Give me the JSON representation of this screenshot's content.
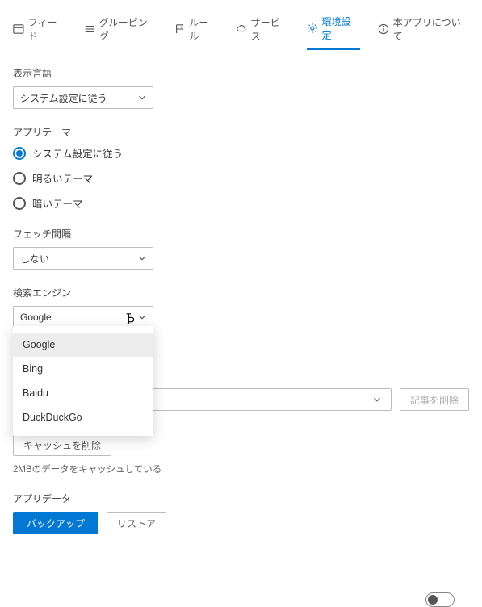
{
  "tabs": {
    "feed": "フィード",
    "grouping": "グルーピング",
    "rule": "ルール",
    "service": "サービス",
    "settings": "環境設定",
    "about": "本アプリについて"
  },
  "lang": {
    "label": "表示言語",
    "value": "システム設定に従う"
  },
  "theme": {
    "label": "アプリテーマ",
    "opt_system": "システム設定に従う",
    "opt_light": "明るいテーマ",
    "opt_dark": "暗いテーマ"
  },
  "fetch": {
    "label": "フェッチ間隔",
    "value": "しない"
  },
  "search": {
    "label": "検索エンジン",
    "value": "Google",
    "opt0": "Google",
    "opt1": "Bing",
    "opt2": "Baidu",
    "opt3": "DuckDuckGo"
  },
  "delete_article_btn": "記事を削除",
  "cache": {
    "clear_btn": "キャッシュを削除",
    "status": "2MBのデータをキャッシュしている"
  },
  "appdata": {
    "label": "アプリデータ",
    "backup": "バックアップ",
    "restore": "リストア"
  }
}
